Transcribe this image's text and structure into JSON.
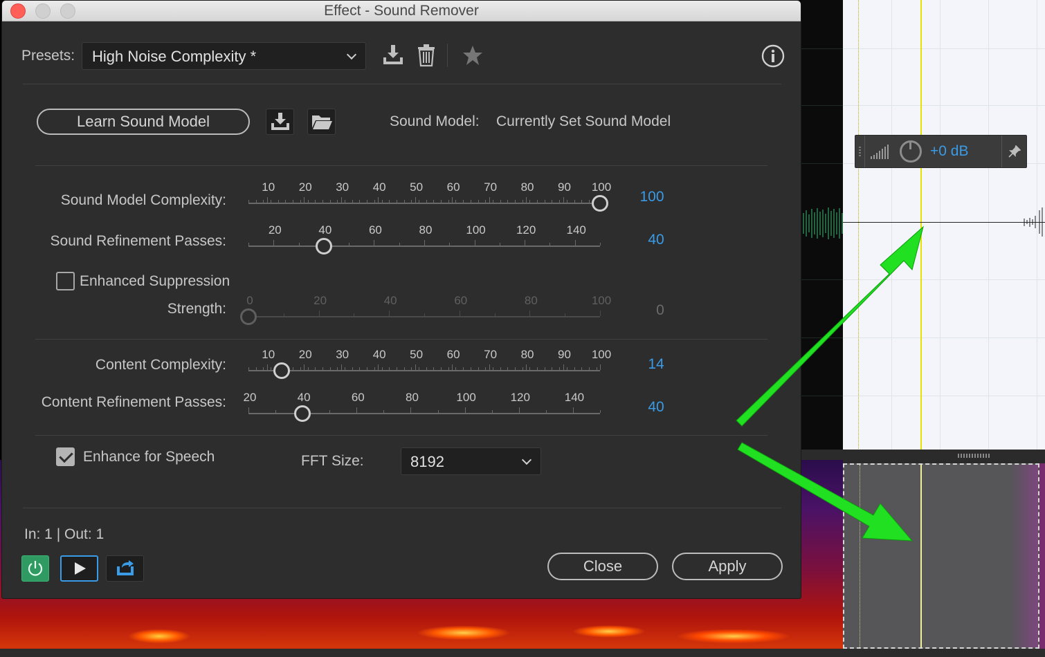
{
  "dialog": {
    "title": "Effect - Sound Remover",
    "presets_label": "Presets:",
    "preset_value": "High Noise Complexity *",
    "learn_button": "Learn Sound Model",
    "sound_model_label": "Sound Model:",
    "sound_model_value": "Currently Set Sound Model",
    "sliders": {
      "sound_model_complexity": {
        "label": "Sound Model Complexity:",
        "ticks": [
          "10",
          "20",
          "30",
          "40",
          "50",
          "60",
          "70",
          "80",
          "90",
          "100"
        ],
        "min": 5,
        "max": 100,
        "value": 100,
        "value_text": "100"
      },
      "sound_refinement_passes": {
        "label": "Sound Refinement Passes:",
        "ticks": [
          "20",
          "40",
          "60",
          "80",
          "100",
          "120",
          "140"
        ],
        "min": 10,
        "max": 150,
        "value": 40,
        "value_text": "40"
      },
      "strength": {
        "label": "Strength:",
        "ticks": [
          "0",
          "20",
          "40",
          "60",
          "80",
          "100"
        ],
        "min": 0,
        "max": 100,
        "value": 0,
        "value_text": "0",
        "disabled": true
      },
      "content_complexity": {
        "label": "Content Complexity:",
        "ticks": [
          "10",
          "20",
          "30",
          "40",
          "50",
          "60",
          "70",
          "80",
          "90",
          "100"
        ],
        "min": 5,
        "max": 100,
        "value": 14,
        "value_text": "14"
      },
      "content_refinement_passes": {
        "label": "Content Refinement Passes:",
        "ticks": [
          "20",
          "40",
          "60",
          "80",
          "100",
          "120",
          "140"
        ],
        "min": 20,
        "max": 150,
        "value": 40,
        "value_text": "40"
      }
    },
    "enhanced_suppression": {
      "label": "Enhanced Suppression",
      "checked": false
    },
    "enhance_for_speech": {
      "label": "Enhance for Speech",
      "checked": true
    },
    "fft_label": "FFT Size:",
    "fft_value": "8192",
    "io_text": "In: 1 | Out: 1",
    "close_button": "Close",
    "apply_button": "Apply",
    "accent_color": "#3a9be6",
    "power_color": "#2f9a62",
    "icons": [
      "info-icon",
      "save-preset-icon",
      "delete-preset-icon",
      "favorite-star-icon",
      "save-model-icon",
      "open-folder-icon",
      "power-icon",
      "play-icon",
      "loop-icon",
      "dropdown-chevron-icon"
    ]
  },
  "hud": {
    "gain_text": "+0 dB"
  },
  "annotation": {
    "arrow_color": "#21e021"
  }
}
